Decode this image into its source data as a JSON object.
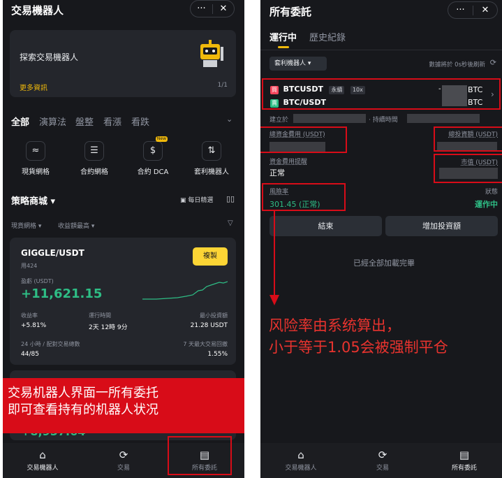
{
  "left": {
    "header_title": "交易機器人",
    "more_btn": "···",
    "close_btn": "✕",
    "banner": {
      "title": "探索交易機器人",
      "link": "更多資訊",
      "page": "1/1"
    },
    "tabs": [
      "全部",
      "演算法",
      "盤整",
      "看漲",
      "看跌"
    ],
    "categories": [
      {
        "label": "現貨網格",
        "icon": "grid-chart-icon"
      },
      {
        "label": "合約網格",
        "icon": "contract-grid-icon"
      },
      {
        "label": "合約 DCA",
        "icon": "dca-icon",
        "badge": "New"
      },
      {
        "label": "套利機器人",
        "icon": "arbitrage-icon"
      }
    ],
    "store_title": "策略商城 ▾",
    "daily_pick": "每日精選",
    "filters": [
      "現貨網格 ▾",
      "收益額最高 ▾"
    ],
    "strategy": {
      "pair": "GIGGLE/USDT",
      "user": "用424",
      "copy_btn": "複製",
      "pnl_label": "盈虧 (USDT)",
      "pnl_value": "+11,621.15",
      "roi_label": "收益率",
      "roi_value": "+5.81%",
      "runtime_label": "運行時間",
      "runtime_value": "2天 12時 9分",
      "min_label": "最小投資額",
      "min_value": "21.28 USDT",
      "trades_label": "24 小時 / 配對交易總數",
      "trades_value": "44/85",
      "dd_label": "7 天最大交易回撤",
      "dd_value": "1.55%"
    },
    "partial_value": "+8,957.64",
    "annotation": [
      "交易机器人界面一所有委托",
      "即可查看持有的机器人状况"
    ],
    "nav": [
      "交易機器人",
      "交易",
      "所有委託"
    ]
  },
  "right": {
    "header_title": "所有委託",
    "more_btn": "···",
    "close_btn": "✕",
    "tabs": [
      "運行中",
      "歷史紀錄"
    ],
    "filter": "套利機器人 ▾",
    "refresh": "數據將於 0s秒後刷新",
    "order": {
      "leg1_side": "買",
      "leg1_pair": "BTCUSDT",
      "leg1_tag1": "永續",
      "leg1_tag2": "10x",
      "leg1_unit": "BTC",
      "leg2_side": "賣",
      "leg2_pair": "BTC/USDT",
      "leg2_unit": "BTC",
      "dash": "-",
      "created_label": "建立於",
      "duration_label": "· 持續時間",
      "total_fee_label": "總資金費用 (USDT)",
      "total_invest_label": "總投資額 (USDT)",
      "fee_alert_label": "資金費用提醒",
      "fee_alert_value": "正常",
      "market_value_label": "市值 (USDT)",
      "risk_label": "風險率",
      "risk_value": "301.45 (正常)",
      "status_label": "狀態",
      "status_value": "運作中"
    },
    "end_btn": "結束",
    "add_btn": "增加投資額",
    "all_loaded": "已經全部加載完畢",
    "annotation": [
      "风险率由系统算出，",
      "小于等于1.05会被强制平仓"
    ],
    "nav": [
      "交易機器人",
      "交易",
      "所有委託"
    ]
  },
  "colors": {
    "accent": "#f0b90b",
    "green": "#2ebd85",
    "red": "#f6465d",
    "annotation_red": "#d80c18"
  }
}
